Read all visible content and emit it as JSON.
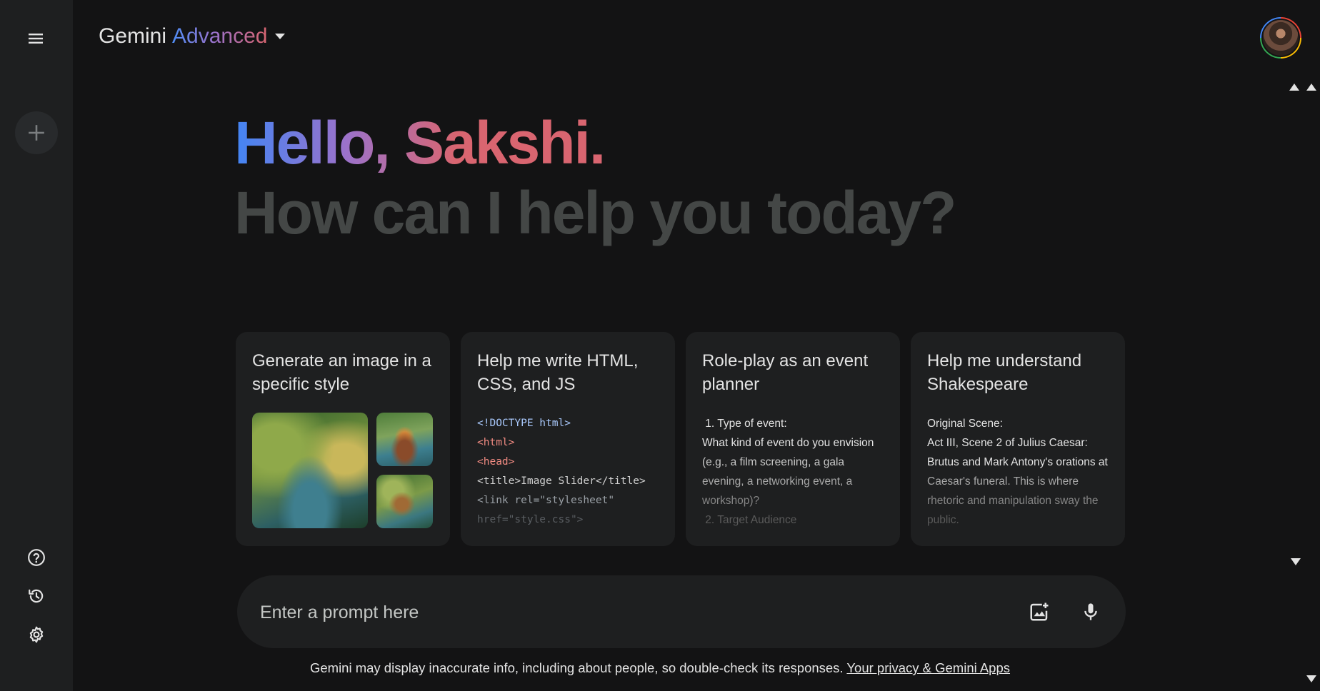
{
  "header": {
    "brand_name": "Gemini",
    "brand_tier": "Advanced"
  },
  "sidebar": {
    "menu_icon": "menu-icon",
    "new_chat_icon": "plus-icon",
    "help_icon": "help-icon",
    "history_icon": "history-icon",
    "settings_icon": "gear-icon"
  },
  "greeting": {
    "hello": "Hello, Sakshi.",
    "subtitle": "How can I help you today?"
  },
  "cards": [
    {
      "title": "Generate an image in a specific style"
    },
    {
      "title": "Help me write HTML, CSS, and JS",
      "code_lines": [
        "<!DOCTYPE html>",
        "<html>",
        "<head>",
        "<title>Image Slider</title>",
        "<link rel=\"stylesheet\"",
        "href=\"style.css\">"
      ]
    },
    {
      "title": "Role-play as an event planner",
      "lines": [
        " 1. Type of event:",
        "What kind of event do you envision",
        "(e.g., a film screening, a gala",
        "evening, a networking event, a",
        "workshop)?",
        " 2. Target Audience"
      ]
    },
    {
      "title": "Help me understand Shakespeare",
      "lines": [
        "Original Scene:",
        "Act III, Scene 2 of Julius Caesar:",
        "Brutus and Mark Antony's orations at",
        "Caesar's funeral. This is where",
        "rhetoric and manipulation sway the",
        "public."
      ]
    }
  ],
  "prompt": {
    "placeholder": "Enter a prompt here"
  },
  "footer": {
    "disclaimer": "Gemini may display inaccurate info, including about people, so double-check its responses.",
    "link": "Your privacy & Gemini Apps"
  },
  "colors": {
    "background": "#131314",
    "sidebar": "#1e1f20",
    "card": "#1e1f20",
    "accent_blue": "#4285f4",
    "accent_pink": "#d96570"
  }
}
